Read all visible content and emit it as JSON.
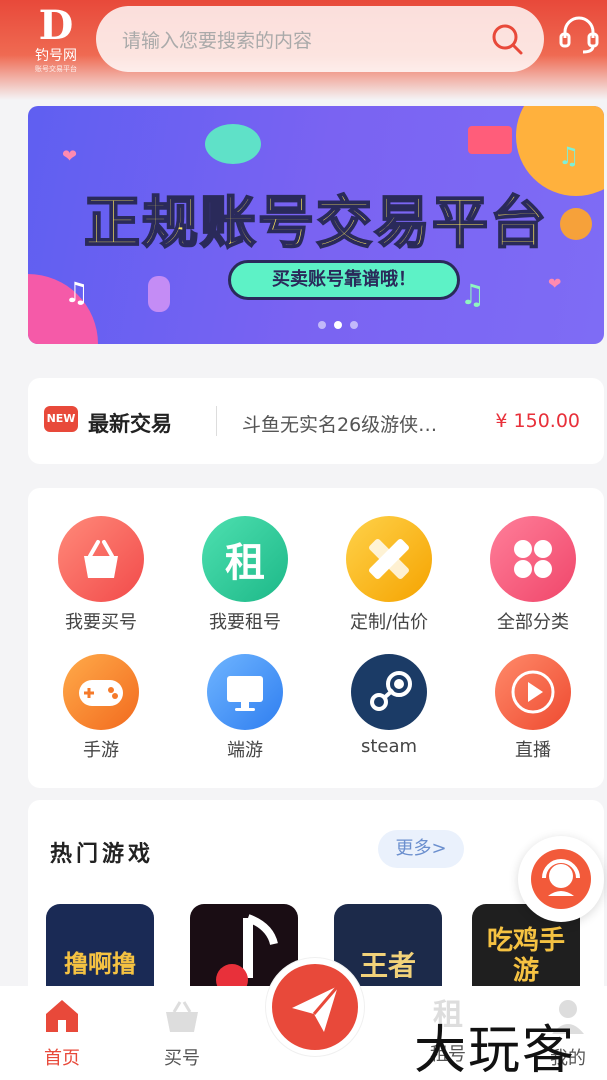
{
  "header": {
    "logo_mark": "D",
    "logo_name": "钓号网",
    "logo_sub": "账号交易平台",
    "search_placeholder": "请输入您要搜索的内容",
    "accent": "#e8493a"
  },
  "banner": {
    "title": "正规账号交易平台",
    "pill": "买卖账号靠谱哦！",
    "dots_count": 3,
    "active_dot": 2
  },
  "latest_trade": {
    "badge": "NEW",
    "label": "最新交易",
    "item": "斗鱼无实名26级游侠…",
    "price": "¥ 150.00"
  },
  "categories": [
    {
      "label": "我要买号",
      "icon": "basket-icon",
      "color": "#f25d5d"
    },
    {
      "label": "我要租号",
      "icon": "rent-icon",
      "glyph": "租",
      "color": "#27c79a"
    },
    {
      "label": "定制/估价",
      "icon": "ruler-pencil-icon",
      "color": "#f5b800"
    },
    {
      "label": "全部分类",
      "icon": "grid-icon",
      "color": "#f3567a"
    },
    {
      "label": "手游",
      "icon": "gamepad-icon",
      "color": "#f57a2a"
    },
    {
      "label": "端游",
      "icon": "monitor-icon",
      "color": "#3b8ff5"
    },
    {
      "label": "steam",
      "icon": "steam-icon",
      "color": "#1b3b66"
    },
    {
      "label": "直播",
      "icon": "play-icon",
      "color": "#f2553c"
    }
  ],
  "hot_games": {
    "title": "热门游戏",
    "more": "更多>",
    "games": [
      {
        "text": "撸啊撸",
        "bg": "#1a2a55",
        "fg": "#f5c242"
      },
      {
        "text": "",
        "bg": "#1a0d14",
        "fg": "#ffffff"
      },
      {
        "text": "王者",
        "bg": "#1c2a4a",
        "fg": "#f2d27a"
      },
      {
        "text": "吃鸡手游",
        "bg": "#1f1f1f",
        "fg": "#f5c242"
      }
    ]
  },
  "nav": {
    "items": [
      {
        "label": "首页",
        "icon": "home-icon",
        "active": true
      },
      {
        "label": "买号",
        "icon": "basket-icon"
      },
      {
        "label": "租号",
        "icon": "rent-icon"
      },
      {
        "label": "我的",
        "icon": "user-icon"
      }
    ],
    "center_icon": "paper-plane-icon"
  },
  "watermark": "大玩客"
}
